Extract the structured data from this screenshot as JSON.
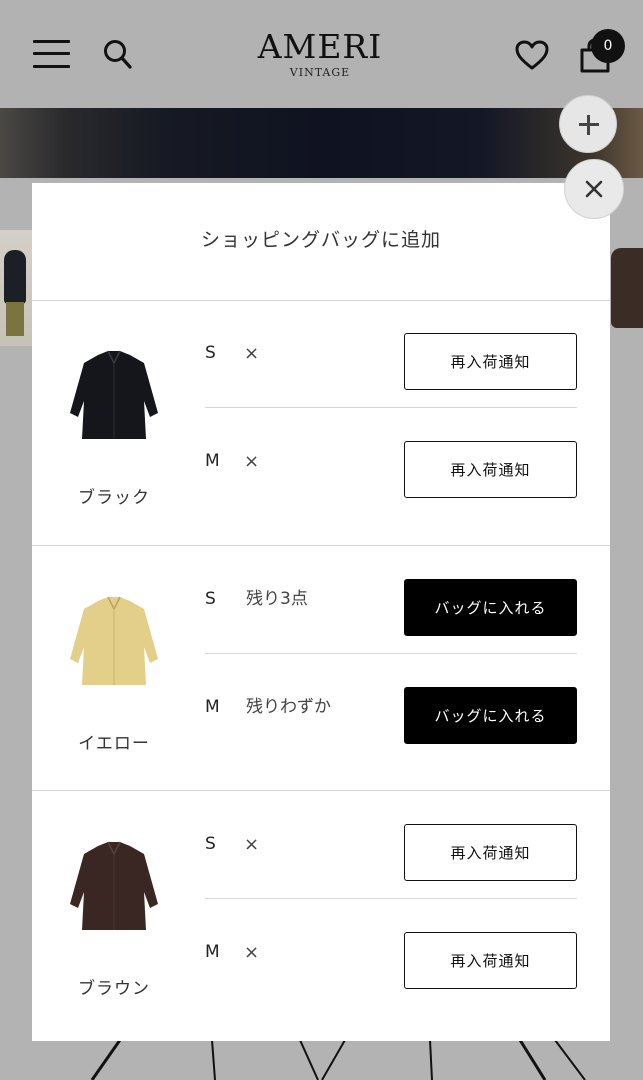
{
  "header": {
    "logo_main": "AMERI",
    "logo_sub": "VINTAGE",
    "bag_count": "0"
  },
  "modal": {
    "title": "ショッピングバッグに追加",
    "colors": [
      {
        "name": "ブラック",
        "image_color": "#15161b",
        "sizes": [
          {
            "size": "S",
            "stock": "×",
            "button": "再入荷通知",
            "in_stock": false
          },
          {
            "size": "M",
            "stock": "×",
            "button": "再入荷通知",
            "in_stock": false
          }
        ]
      },
      {
        "name": "イエロー",
        "image_color": "#e3cf8a",
        "sizes": [
          {
            "size": "S",
            "stock": "残り3点",
            "button": "バッグに入れる",
            "in_stock": true
          },
          {
            "size": "M",
            "stock": "残りわずか",
            "button": "バッグに入れる",
            "in_stock": true
          }
        ]
      },
      {
        "name": "ブラウン",
        "image_color": "#3a2723",
        "sizes": [
          {
            "size": "S",
            "stock": "×",
            "button": "再入荷通知",
            "in_stock": false
          },
          {
            "size": "M",
            "stock": "×",
            "button": "再入荷通知",
            "in_stock": false
          }
        ]
      }
    ]
  },
  "icons": {
    "menu": "hamburger-menu-icon",
    "search": "search-icon",
    "wishlist": "heart-icon",
    "bag": "shopping-bag-icon",
    "close": "close-icon",
    "add": "plus-icon"
  }
}
